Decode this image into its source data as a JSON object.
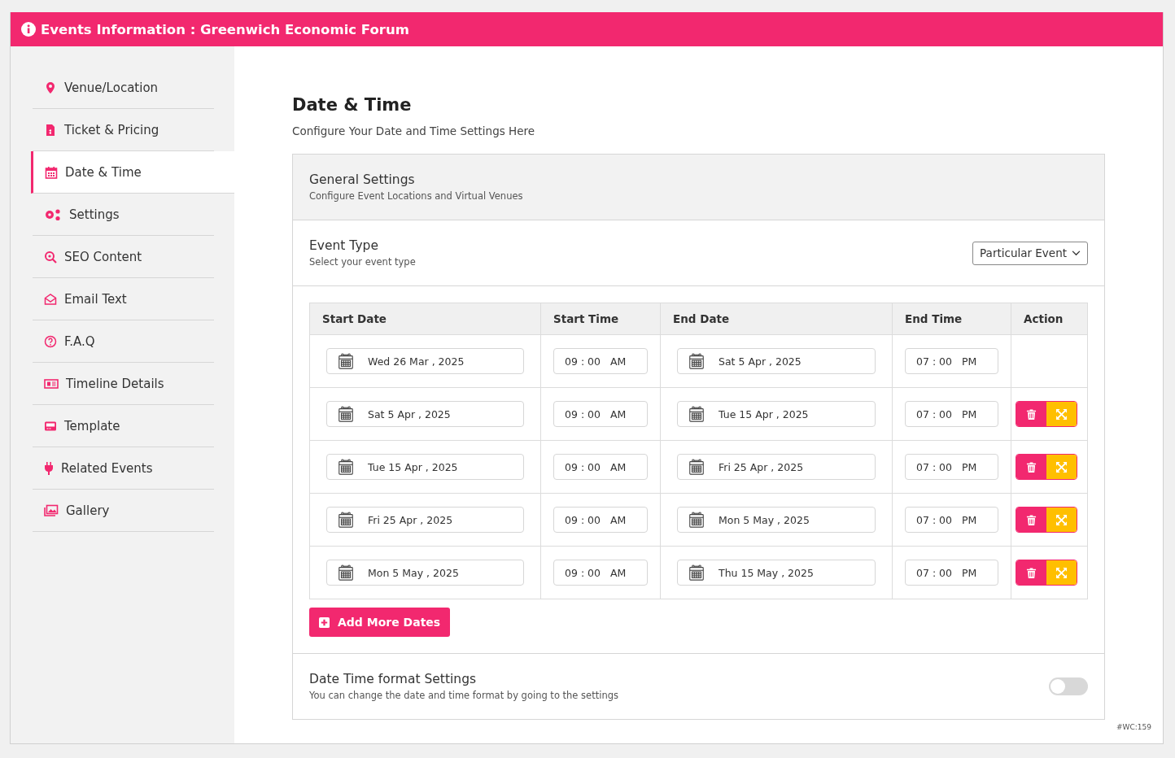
{
  "header": {
    "title": "Events Information : Greenwich Economic Forum"
  },
  "sidebar": {
    "items": [
      {
        "label": "Venue/Location",
        "selected": false
      },
      {
        "label": "Ticket & Pricing",
        "selected": false
      },
      {
        "label": "Date & Time",
        "selected": true
      },
      {
        "label": "Settings",
        "selected": false
      },
      {
        "label": "SEO Content",
        "selected": false
      },
      {
        "label": "Email Text",
        "selected": false
      },
      {
        "label": "F.A.Q",
        "selected": false
      },
      {
        "label": "Timeline Details",
        "selected": false
      },
      {
        "label": "Template",
        "selected": false
      },
      {
        "label": "Related Events",
        "selected": false
      },
      {
        "label": "Gallery",
        "selected": false
      }
    ]
  },
  "page": {
    "title": "Date & Time",
    "subtitle": "Configure Your Date and Time Settings Here"
  },
  "general": {
    "title": "General Settings",
    "subtitle": "Configure Event Locations and Virtual Venues"
  },
  "event_type": {
    "title": "Event Type",
    "subtitle": "Select your event type",
    "value": "Particular Event"
  },
  "table": {
    "columns": [
      "Start Date",
      "Start Time",
      "End Date",
      "End Time",
      "Action"
    ],
    "rows": [
      {
        "start_date": "Wed 26 Mar , 2025",
        "start_time": "09 : 00   AM",
        "end_date": "Sat 5 Apr , 2025",
        "end_time": "07 : 00   PM",
        "removable": false
      },
      {
        "start_date": "Sat 5 Apr , 2025",
        "start_time": "09 : 00   AM",
        "end_date": "Tue 15 Apr , 2025",
        "end_time": "07 : 00   PM",
        "removable": true
      },
      {
        "start_date": "Tue 15 Apr , 2025",
        "start_time": "09 : 00   AM",
        "end_date": "Fri 25 Apr , 2025",
        "end_time": "07 : 00   PM",
        "removable": true
      },
      {
        "start_date": "Fri 25 Apr , 2025",
        "start_time": "09 : 00   AM",
        "end_date": "Mon 5 May , 2025",
        "end_time": "07 : 00   PM",
        "removable": true
      },
      {
        "start_date": "Mon 5 May , 2025",
        "start_time": "09 : 00   AM",
        "end_date": "Thu 15 May , 2025",
        "end_time": "07 : 00   PM",
        "removable": true
      }
    ]
  },
  "add_button": {
    "label": "Add More Dates"
  },
  "format": {
    "title": "Date Time format Settings",
    "subtitle": "You can change the date and time format by going to the settings",
    "on": false
  },
  "footer_code": "#WC:159"
}
